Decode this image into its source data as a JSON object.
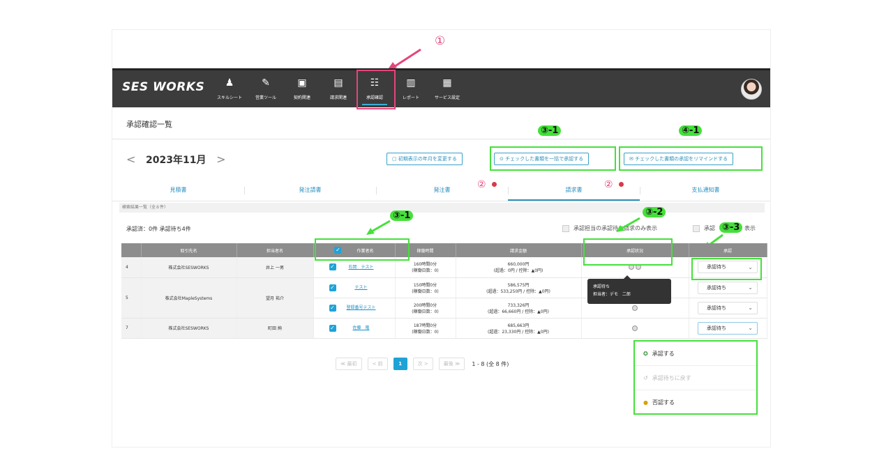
{
  "annotations": {
    "circle_one": "①",
    "circle_two": "②",
    "label_3_1": "③-1",
    "label_3_2": "③-2",
    "label_3_3": "③-3",
    "label_4_1": "④-1"
  },
  "app": {
    "logo": "SES WORKS",
    "nav": [
      {
        "icon": "♟",
        "label": "スキルシート"
      },
      {
        "icon": "✎",
        "label": "営業ツール"
      },
      {
        "icon": "▣",
        "label": "契約関連"
      },
      {
        "icon": "▤",
        "label": "請求関連"
      },
      {
        "icon": "☷",
        "label": "承認確認"
      },
      {
        "icon": "▥",
        "label": "レポート"
      },
      {
        "icon": "▦",
        "label": "サービス設定"
      }
    ]
  },
  "page": {
    "title": "承認確認一覧",
    "prev": "<",
    "month": "2023年11月",
    "next": ">",
    "btn_default_month": "▢ 初期表示の年月を変更する",
    "btn_bulk_approve": "⊙ チェックした書類を一括で承認する",
    "btn_remind": "✉ チェックした書類の承認をリマインドする"
  },
  "tabs": [
    "見積書",
    "発注請書",
    "発注書",
    "請求書",
    "支払通知書"
  ],
  "results": {
    "summary": "検索結果一覧（全８件）",
    "counts": "承認済：0件  承認待ち4件",
    "filter_1": "承認担当の承認待ち請求のみ表示",
    "filter_2": "承認",
    "filter_2_tail": "表示"
  },
  "table": {
    "headers": [
      "",
      "取引先名",
      "担当者名",
      "作業者名",
      "稼働時間",
      "請求金額",
      "承認状況",
      "承認"
    ],
    "rows": [
      {
        "no": "4",
        "client": "株式会社SESWORKS",
        "manager": "井上 一男",
        "worker": "石岡　テスト",
        "hours": "160時間0分",
        "days": "(稼働日数：0)",
        "amount": "660,000円",
        "detail": "(超過：0円 / 控除：▲0円)",
        "status": "承認待ち"
      },
      {
        "no": "5",
        "client": "株式会社MapleSystems",
        "manager": "望月 祐介",
        "worker": "テスト",
        "hours": "150時間0分",
        "days": "(稼働日数：0)",
        "amount": "586,575円",
        "detail": "(超過：533,250円 / 控除：▲0円)",
        "status": "承認待ち"
      },
      {
        "no": "",
        "client": "",
        "manager": "",
        "worker": "登録番号テスト",
        "hours": "200時間0分",
        "days": "(稼働日数：0)",
        "amount": "733,326円",
        "detail": "(超過：66,660円 / 控除：▲0円)",
        "status": "承認待ち"
      },
      {
        "no": "7",
        "client": "株式会社SESWORKS",
        "manager": "町田 絢",
        "worker": "佐藤　隆",
        "hours": "187時間0分",
        "days": "(稼働日数：0)",
        "amount": "685,663円",
        "detail": "(超過：23,330円 / 控除：▲0円)",
        "status": "承認待ち"
      }
    ]
  },
  "tooltip": {
    "line1": "承認待ち",
    "line2": "担当者：デモ　二郎"
  },
  "pager": {
    "first": "≪ 最初",
    "prev": "< 前",
    "current": "1",
    "next": "次 >",
    "last": "最後 ≫",
    "info": "1 - 8 (全 8 件)"
  },
  "dropdown": {
    "approve": "承認する",
    "revert": "承認待ちに戻す",
    "reject": "否認する"
  },
  "colors": {
    "accent": "#2a8fbd",
    "annotation_green": "#45e03a",
    "annotation_pink": "#e6447a",
    "navbar": "#3c3c3c"
  }
}
